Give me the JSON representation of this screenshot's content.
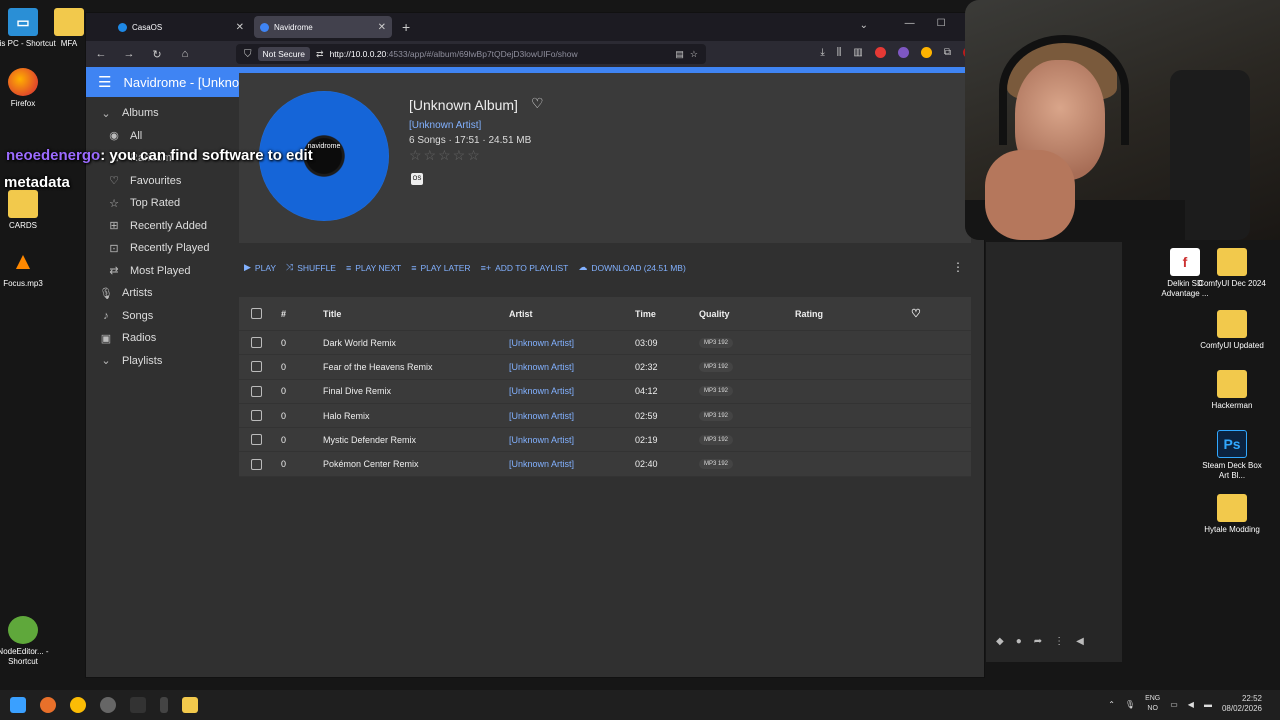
{
  "desktop": {
    "left_icons": [
      {
        "label": "This PC - Shortcut",
        "icon": "pc-icon"
      },
      {
        "label": "MFA",
        "icon": "folder-icon"
      },
      {
        "label": "Firefox",
        "icon": "firefox-icon"
      },
      {
        "label": "CARDS",
        "icon": "folder-icon"
      },
      {
        "label": "Focus.mp3",
        "icon": "vlc-icon"
      },
      {
        "label": "NodeEditor... - Shortcut",
        "icon": "node-icon"
      }
    ],
    "right_icons": [
      {
        "label": "Delkin SD Advantage ...",
        "icon": "delkin-icon"
      },
      {
        "label": "ComfyUI Dec 2024",
        "icon": "folder-icon"
      },
      {
        "label": "ComfyUI Updated",
        "icon": "folder-icon"
      },
      {
        "label": "Hackerman",
        "icon": "folder-icon"
      },
      {
        "label": "Steam Deck Box Art Bl...",
        "icon": "photoshop-icon"
      },
      {
        "label": "Hytale Modding",
        "icon": "folder-icon"
      }
    ]
  },
  "overlay": {
    "user": "neoedenergo",
    "message": ": you can find software to edit",
    "line2": "metadata"
  },
  "browser": {
    "tabs": [
      {
        "title": "CasaOS",
        "color": "#1e88e5"
      },
      {
        "title": "Navidrome",
        "color": "#3f84f3"
      }
    ],
    "not_secure": "Not Secure",
    "url_host": "http://10.0.0.20",
    "url_rest": ":4533/app/#/album/69lwBp7tQDejD3lowUIFo/show"
  },
  "app": {
    "title": "Navidrome - [Unknown Album]",
    "sidebar": {
      "albums": "Albums",
      "album_items": [
        "All",
        "Random",
        "Favourites",
        "Top Rated",
        "Recently Added",
        "Recently Played",
        "Most Played"
      ],
      "artists": "Artists",
      "songs": "Songs",
      "radios": "Radios",
      "playlists": "Playlists"
    },
    "album": {
      "cover_label": "navidrome",
      "title": "[Unknown Album]",
      "artist": "[Unknown Artist]",
      "meta": "6 Songs · 17:51 · 24.51 MB",
      "stars": "☆☆☆☆☆",
      "badge": "OS"
    },
    "actions": [
      {
        "icon": "▶",
        "label": "PLAY"
      },
      {
        "icon": "⤨",
        "label": "SHUFFLE"
      },
      {
        "icon": "≡",
        "label": "PLAY NEXT"
      },
      {
        "icon": "≡",
        "label": "PLAY LATER"
      },
      {
        "icon": "≡+",
        "label": "ADD TO PLAYLIST"
      },
      {
        "icon": "☁",
        "label": "DOWNLOAD (24.51 MB)"
      }
    ],
    "table": {
      "headers": {
        "num": "#",
        "title": "Title",
        "artist": "Artist",
        "time": "Time",
        "quality": "Quality",
        "rating": "Rating"
      },
      "rows": [
        {
          "num": "0",
          "title": "Dark World Remix",
          "artist": "[Unknown Artist]",
          "time": "03:09",
          "quality": "MP3 192"
        },
        {
          "num": "0",
          "title": "Fear of the Heavens Remix",
          "artist": "[Unknown Artist]",
          "time": "02:32",
          "quality": "MP3 192"
        },
        {
          "num": "0",
          "title": "Final Dive Remix",
          "artist": "[Unknown Artist]",
          "time": "04:12",
          "quality": "MP3 192"
        },
        {
          "num": "0",
          "title": "Halo Remix",
          "artist": "[Unknown Artist]",
          "time": "02:59",
          "quality": "MP3 192"
        },
        {
          "num": "0",
          "title": "Mystic Defender Remix",
          "artist": "[Unknown Artist]",
          "time": "02:19",
          "quality": "MP3 192"
        },
        {
          "num": "0",
          "title": "Pokémon Center Remix",
          "artist": "[Unknown Artist]",
          "time": "02:40",
          "quality": "MP3 192"
        }
      ]
    }
  },
  "taskbar": {
    "lang": "ENG",
    "lang2": "NO",
    "time": "22:52",
    "date": "08/02/2026"
  }
}
